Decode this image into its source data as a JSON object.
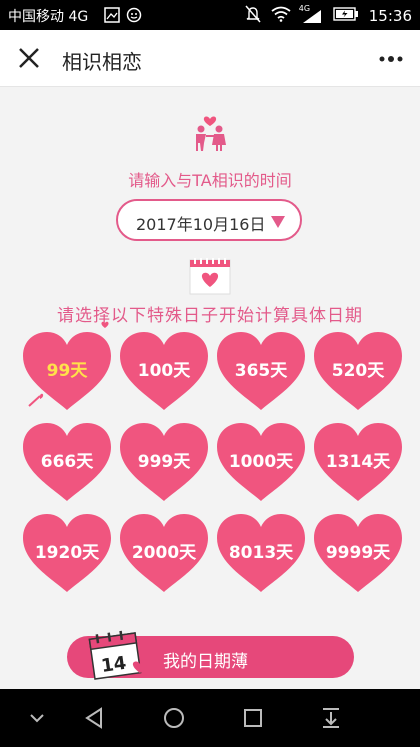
{
  "statusbar": {
    "carrier": "中国移动 4G",
    "network": "4G",
    "time": "15:36"
  },
  "titlebar": {
    "title": "相识相恋"
  },
  "main": {
    "prompt": "请输入与TA相识的时间",
    "date_value": "2017年10月16日",
    "heading": "请选择以下特殊日子开始计算具体日期",
    "days": [
      {
        "label": "99天",
        "selected": true
      },
      {
        "label": "100天",
        "selected": false
      },
      {
        "label": "365天",
        "selected": false
      },
      {
        "label": "520天",
        "selected": false
      },
      {
        "label": "666天",
        "selected": false
      },
      {
        "label": "999天",
        "selected": false
      },
      {
        "label": "1000天",
        "selected": false
      },
      {
        "label": "1314天",
        "selected": false
      },
      {
        "label": "1920天",
        "selected": false
      },
      {
        "label": "2000天",
        "selected": false
      },
      {
        "label": "8013天",
        "selected": false
      },
      {
        "label": "9999天",
        "selected": false
      }
    ],
    "diary_button": "我的日期薄",
    "diary_icon_number": "14"
  },
  "colors": {
    "accent": "#e35a8a",
    "heart": "#f0557f",
    "selected_text": "#ffe14a"
  }
}
